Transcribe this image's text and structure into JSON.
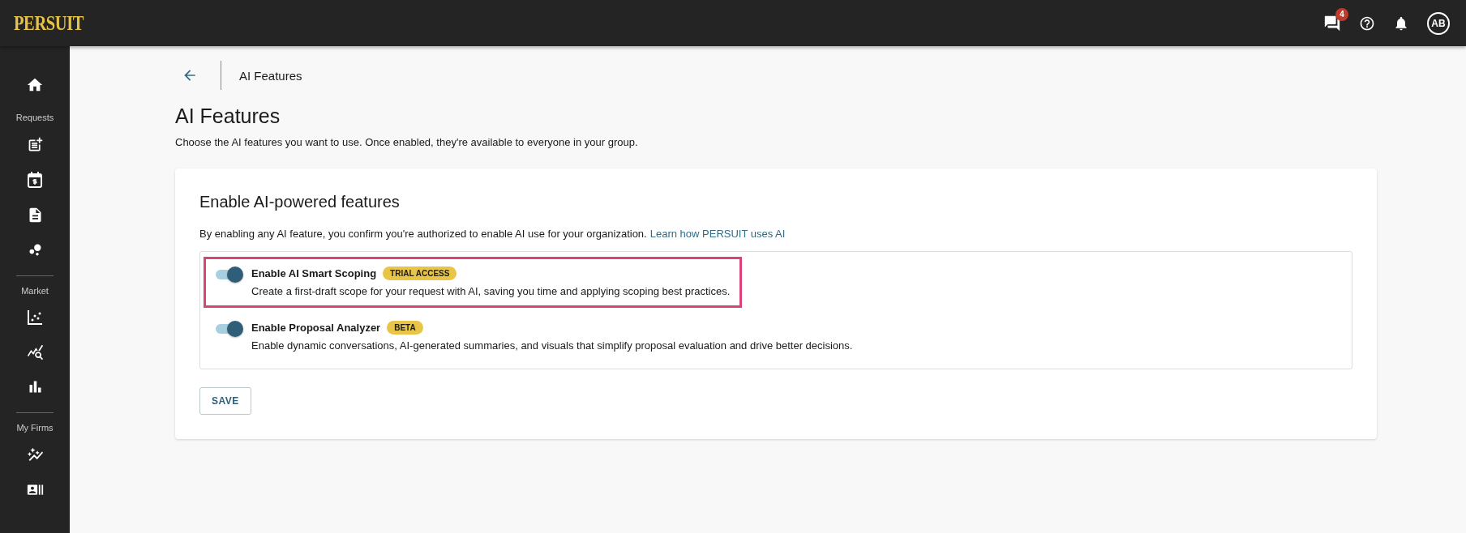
{
  "header": {
    "logo": "PERSUIT",
    "messages_count": "4",
    "avatar": "AB"
  },
  "sidebar": {
    "sections": [
      {
        "label": "Requests"
      },
      {
        "label": "Market"
      },
      {
        "label": "My Firms"
      }
    ]
  },
  "breadcrumb": {
    "title": "AI Features"
  },
  "page": {
    "title": "AI Features",
    "subtitle": "Choose the AI features you want to use. Once enabled, they're available to everyone in your group."
  },
  "card": {
    "title": "Enable AI-powered features",
    "notice": "By enabling any AI feature, you confirm you're authorized to enable AI use for your organization.",
    "link": "Learn how PERSUIT uses AI",
    "options": [
      {
        "label": "Enable AI Smart Scoping",
        "badge": "TRIAL ACCESS",
        "description": "Create a first-draft scope for your request with AI, saving you time and applying scoping best practices.",
        "on": true,
        "highlighted": true
      },
      {
        "label": "Enable Proposal Analyzer",
        "badge": "BETA",
        "description": "Enable dynamic conversations, AI-generated summaries, and visuals that simplify proposal evaluation and drive better decisions.",
        "on": true,
        "highlighted": false
      }
    ],
    "button": "SAVE"
  }
}
